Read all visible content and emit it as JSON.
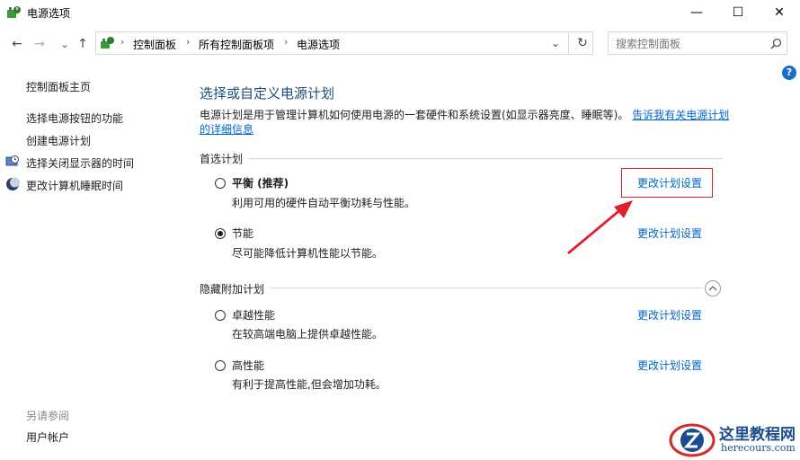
{
  "window": {
    "title": "电源选项",
    "minimize": "—",
    "maximize": "☐",
    "close": "✕",
    "icon": "power-options-icon"
  },
  "nav": {
    "back": "←",
    "forward": "→",
    "recent": "⌄",
    "up": "↑",
    "refresh": "↻",
    "dropdown": "⌄",
    "breadcrumb": [
      "控制面板",
      "所有控制面板项",
      "电源选项"
    ],
    "search_placeholder": "搜索控制面板"
  },
  "sidebar": {
    "home": "控制面板主页",
    "items": [
      {
        "label": "选择电源按钮的功能",
        "icon": null
      },
      {
        "label": "创建电源计划",
        "icon": null
      },
      {
        "label": "选择关闭显示器的时间",
        "icon": "display-clock-icon"
      },
      {
        "label": "更改计算机睡眠时间",
        "icon": "moon-icon"
      }
    ],
    "see_also": "另请参阅",
    "user_accounts": "用户帐户"
  },
  "main": {
    "heading": "选择或自定义电源计划",
    "description": "电源计划是用于管理计算机如何使用电源的一套硬件和系统设置(如显示器亮度、睡眠等)。",
    "description_link": "告诉我有关电源计划的详细信息",
    "preferred_label": "首选计划",
    "hidden_label": "隐藏附加计划",
    "plans": [
      {
        "name": "平衡 (推荐)",
        "desc": "利用可用的硬件自动平衡功耗与性能。",
        "selected": false,
        "link": "更改计划设置"
      },
      {
        "name": "节能",
        "desc": "尽可能降低计算机性能以节能。",
        "selected": true,
        "link": "更改计划设置"
      },
      {
        "name": "卓越性能",
        "desc": "在较高端电脑上提供卓越性能。",
        "selected": false,
        "link": "更改计划设置"
      },
      {
        "name": "高性能",
        "desc": "有利于提高性能,但会增加功耗。",
        "selected": false,
        "link": "更改计划设置"
      }
    ],
    "help": "?"
  },
  "watermark": {
    "name": "这里教程网",
    "url": "herecours.com"
  },
  "colors": {
    "link": "#0066cc",
    "heading": "#1e4e79",
    "annotation": "#e0202a"
  }
}
